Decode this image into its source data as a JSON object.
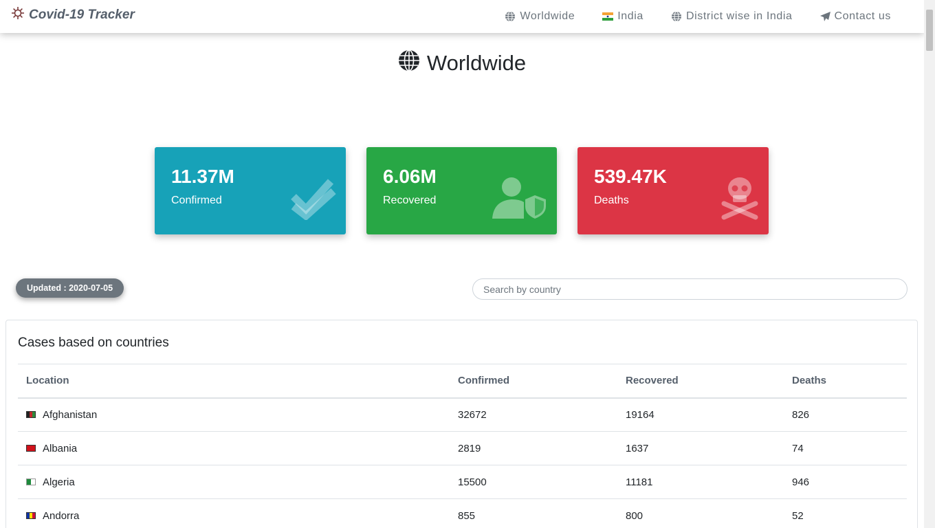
{
  "navbar": {
    "brand": "Covid-19 Tracker",
    "links": [
      {
        "label": "Worldwide",
        "icon": "globe-icon"
      },
      {
        "label": "India",
        "icon": "india-flag-icon"
      },
      {
        "label": "District wise in India",
        "icon": "globe-icon"
      },
      {
        "label": "Contact us",
        "icon": "paper-plane-icon"
      }
    ]
  },
  "page_title": "Worldwide",
  "stats": {
    "confirmed": {
      "value": "11.37M",
      "label": "Confirmed",
      "color": "#17a2b8",
      "icon": "double-check-icon"
    },
    "recovered": {
      "value": "6.06M",
      "label": "Recovered",
      "color": "#28a745",
      "icon": "user-shield-icon"
    },
    "deaths": {
      "value": "539.47K",
      "label": "Deaths",
      "color": "#dc3545",
      "icon": "skull-crossbones-icon"
    }
  },
  "updated": "Updated : 2020-07-05",
  "search": {
    "placeholder": "Search by country",
    "value": ""
  },
  "table": {
    "title": "Cases based on countries",
    "headers": [
      "Location",
      "Confirmed",
      "Recovered",
      "Deaths"
    ],
    "rows": [
      {
        "location": "Afghanistan",
        "confirmed": "32672",
        "recovered": "19164",
        "deaths": "826"
      },
      {
        "location": "Albania",
        "confirmed": "2819",
        "recovered": "1637",
        "deaths": "74"
      },
      {
        "location": "Algeria",
        "confirmed": "15500",
        "recovered": "11181",
        "deaths": "946"
      },
      {
        "location": "Andorra",
        "confirmed": "855",
        "recovered": "800",
        "deaths": "52"
      }
    ]
  },
  "colors": {
    "accent": "#6c757d",
    "navbar_bg": "#ffffff"
  }
}
